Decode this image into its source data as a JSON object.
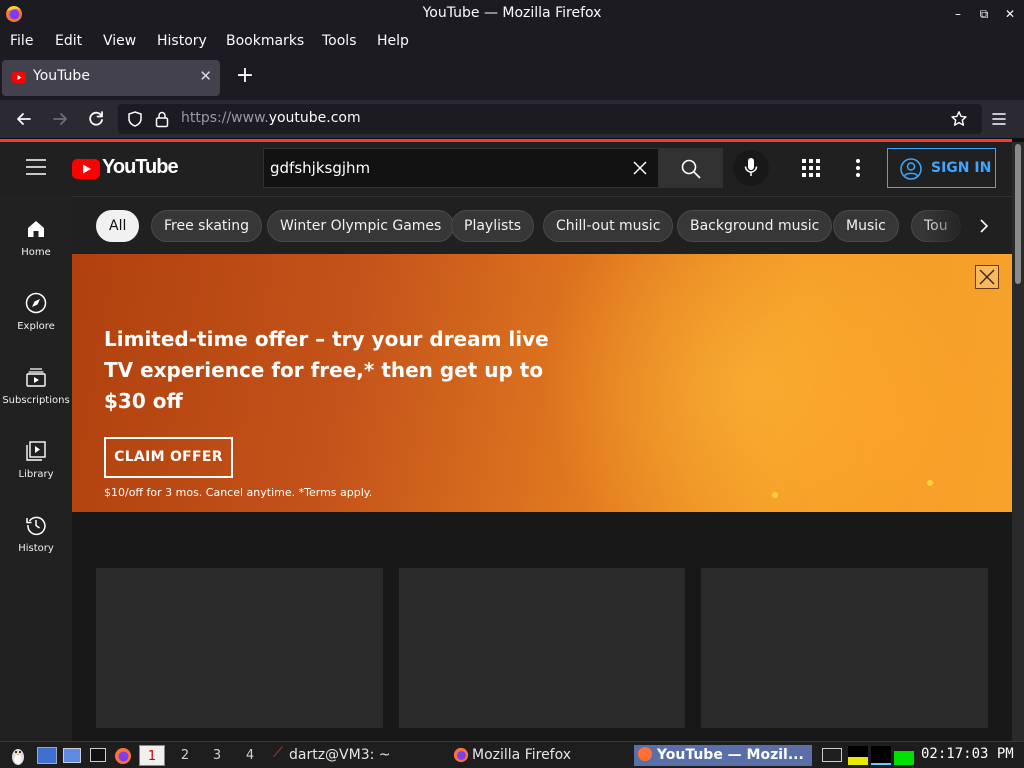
{
  "window": {
    "title": "YouTube — Mozilla Firefox"
  },
  "menu": {
    "file": "File",
    "edit": "Edit",
    "view": "View",
    "history": "History",
    "bookmarks": "Bookmarks",
    "tools": "Tools",
    "help": "Help"
  },
  "tab": {
    "title": "YouTube"
  },
  "urlbar": {
    "prefix": "https://www.",
    "domain": "youtube.com"
  },
  "youtube": {
    "logo_text": "YouTube",
    "search_value": "gdfshjksgjhm",
    "signin_label": "SIGN IN",
    "sidebar": [
      {
        "label": "Home",
        "icon": "home-icon"
      },
      {
        "label": "Explore",
        "icon": "compass-icon"
      },
      {
        "label": "Subscriptions",
        "icon": "subscriptions-icon"
      },
      {
        "label": "Library",
        "icon": "library-icon"
      },
      {
        "label": "History",
        "icon": "history-icon"
      }
    ],
    "chips": [
      "All",
      "Free skating",
      "Winter Olympic Games",
      "Playlists",
      "Chill-out music",
      "Background music",
      "Music",
      "Tou"
    ],
    "banner": {
      "headline": "Limited-time offer – try your dream live TV experience for free,* then get up to $30 off",
      "cta": "CLAIM OFFER",
      "terms": "$10/off for 3 mos. Cancel anytime. *Terms apply."
    }
  },
  "taskbar": {
    "workspaces": [
      "1",
      "2",
      "3",
      "4"
    ],
    "active_workspace": "1",
    "tasks": [
      "dartz@VM3: ~",
      "Mozilla Firefox",
      "YouTube — Mozil..."
    ],
    "clock": "02:17:03 PM"
  },
  "colors": {
    "accent_red": "#ff0000",
    "signin_blue": "#3ea6ff",
    "banner_orange": "#e0781f"
  }
}
